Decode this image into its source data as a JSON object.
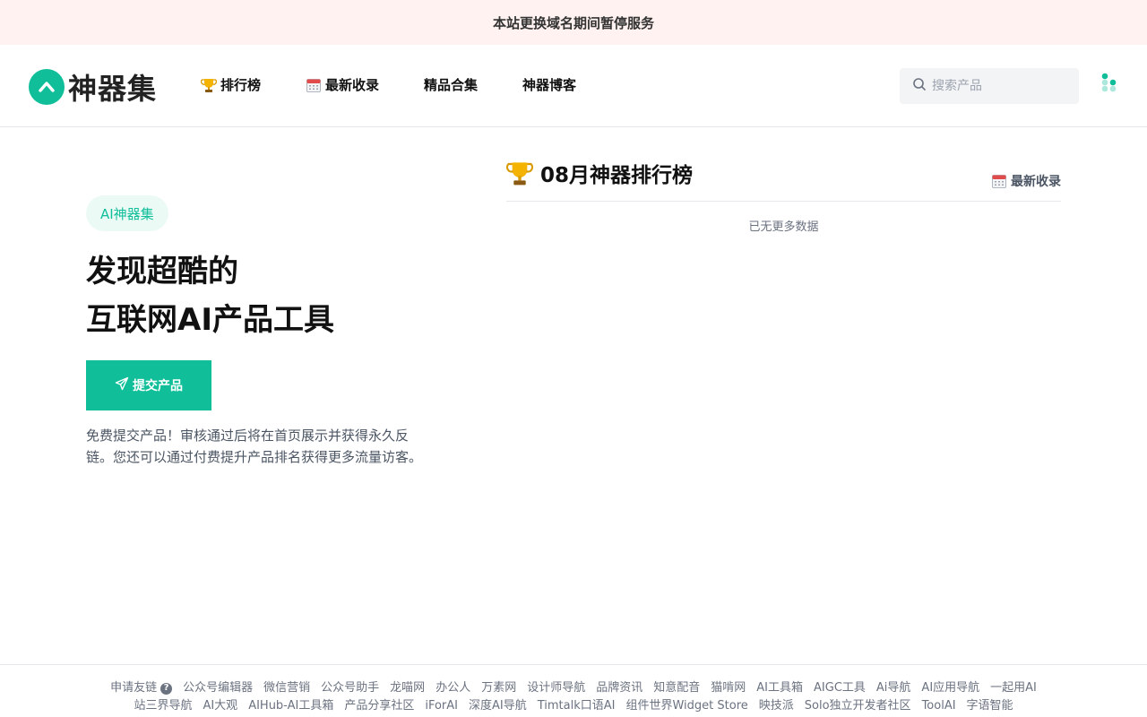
{
  "notice": "本站更换域名期间暂停服务",
  "brand": {
    "name": "神器集",
    "color": "#10bf9a"
  },
  "nav": [
    {
      "label": "排行榜",
      "icon": "trophy-icon"
    },
    {
      "label": "最新收录",
      "icon": "calendar-icon"
    },
    {
      "label": "精品合集",
      "icon": ""
    },
    {
      "label": "神器博客",
      "icon": ""
    }
  ],
  "search": {
    "placeholder": "搜索产品",
    "icon": "search-icon"
  },
  "hero": {
    "badge": "AI神器集",
    "headline_line1": "发现超酷的",
    "headline_line2": "互联网AI产品工具",
    "submit_label": "提交产品",
    "description": "免费提交产品！审核通过后将在首页展示并获得永久反链。您还可以通过付费提升产品排名获得更多流量访客。"
  },
  "ranking": {
    "title": "08月神器排行榜",
    "latest_link": "最新收录",
    "empty_text": "已无更多数据"
  },
  "footer": {
    "apply_label": "申请友链",
    "links": [
      "公众号编辑器",
      "微信营销",
      "公众号助手",
      "龙喵网",
      "办公人",
      "万素网",
      "设计师导航",
      "品牌资讯",
      "知意配音",
      "猫啃网",
      "AI工具箱",
      "AIGC工具",
      "Ai导航",
      "AI应用导航",
      "一起用AI",
      "站三界导航",
      "AI大观",
      "AIHub-AI工具箱",
      "产品分享社区",
      "iForAI",
      "深度AI导航",
      "Timtalk口语AI",
      "组件世界Widget Store",
      "映技派",
      "Solo独立开发者社区",
      "ToolAI",
      "字语智能"
    ]
  }
}
